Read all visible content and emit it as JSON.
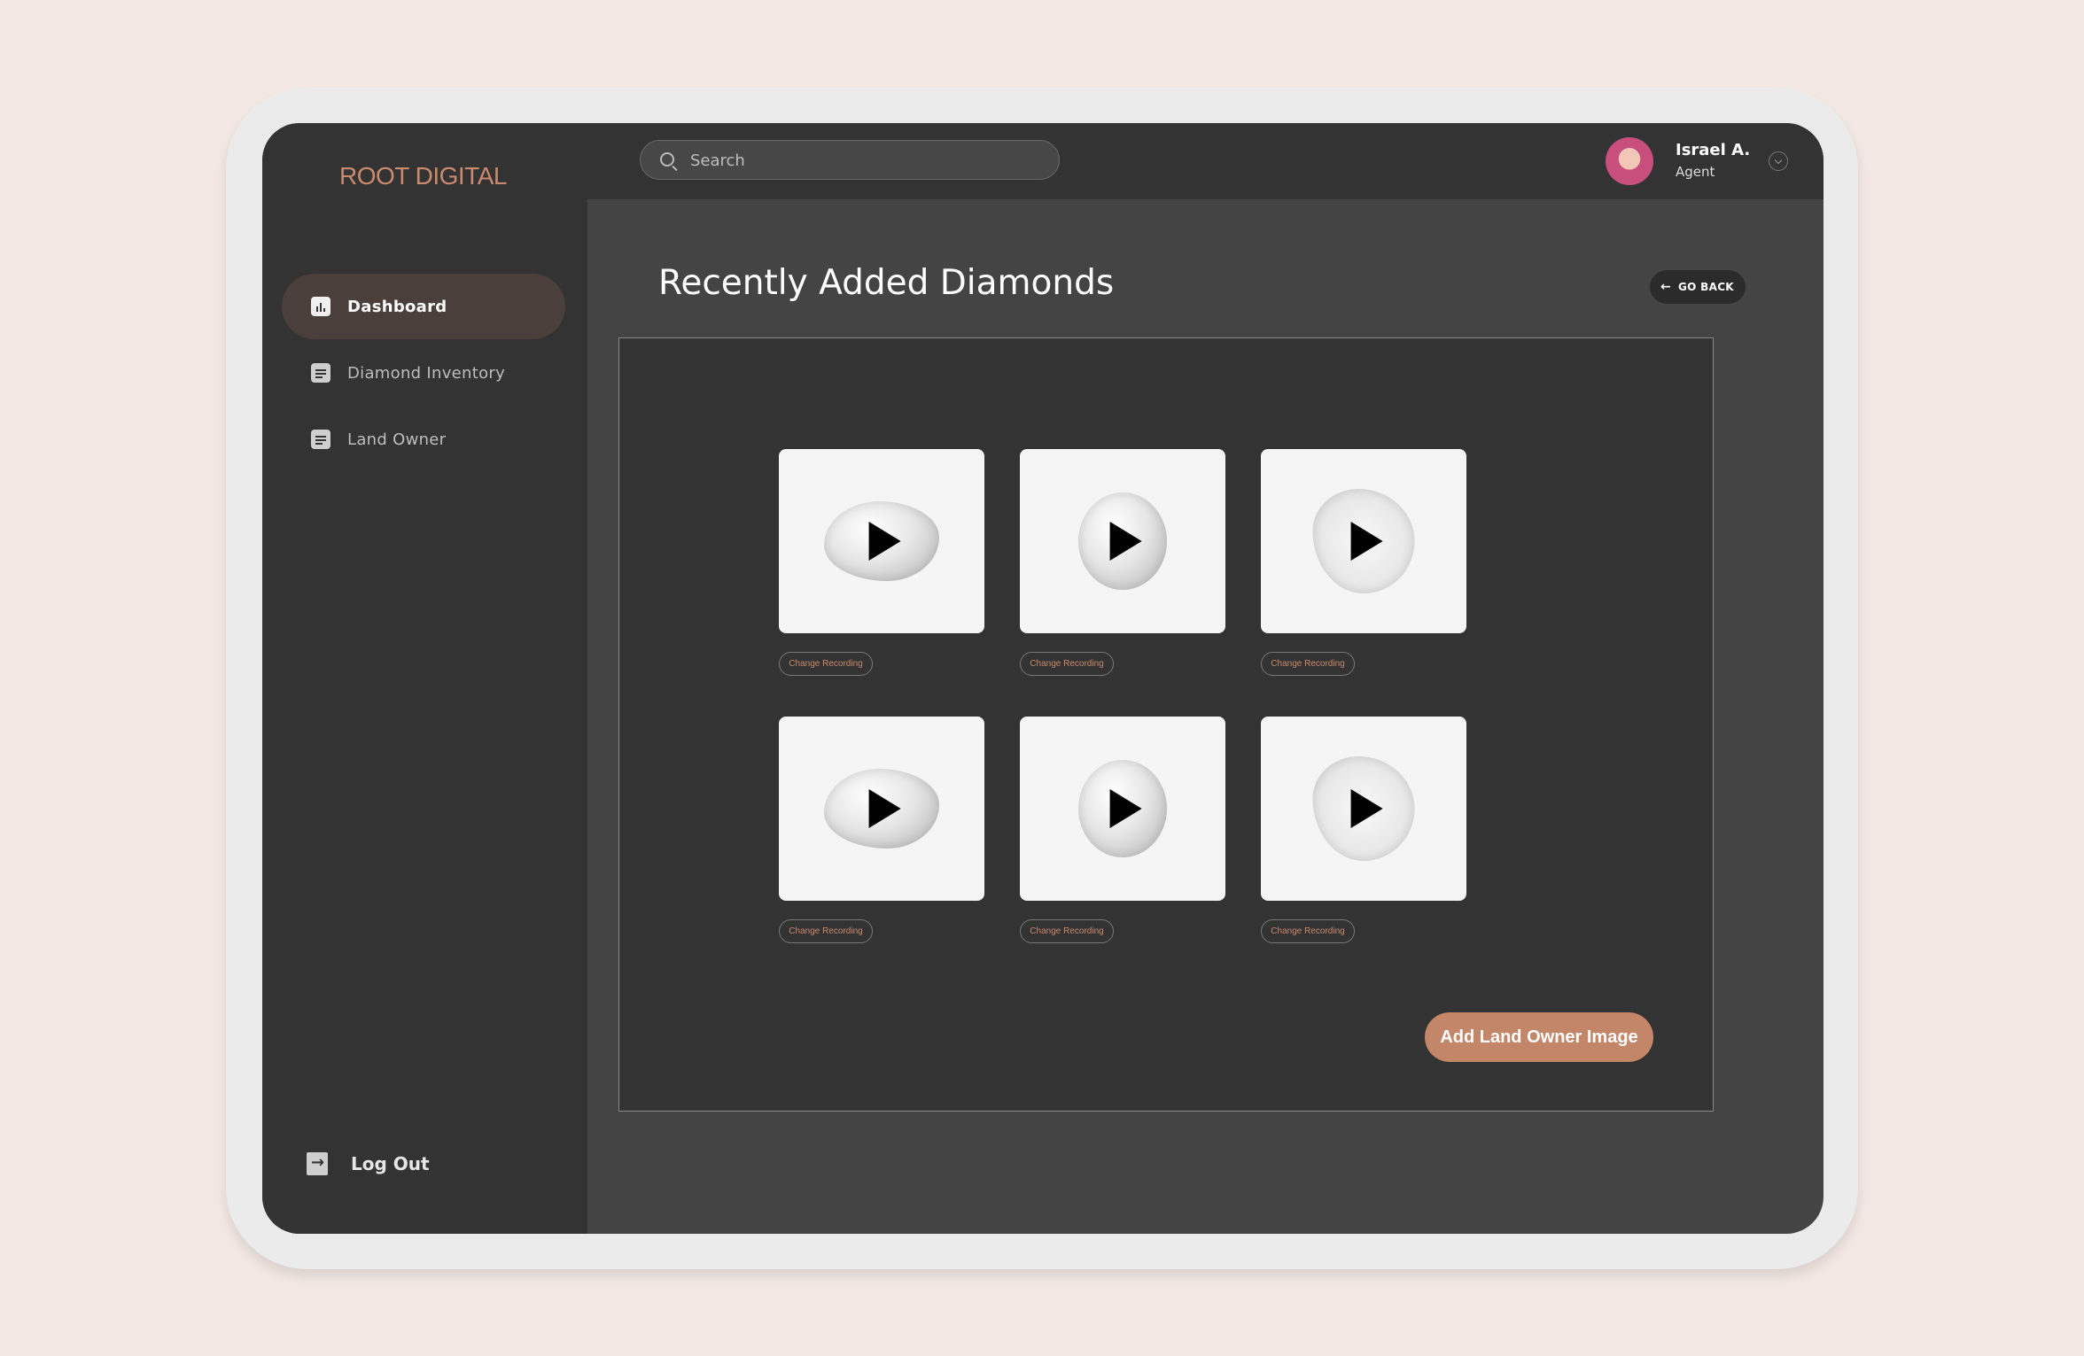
{
  "brand": {
    "logo": "ROOT DIGITAL"
  },
  "sidebar": {
    "items": [
      {
        "label": "Dashboard",
        "icon": "chart-icon",
        "active": true
      },
      {
        "label": "Diamond Inventory",
        "icon": "document-icon",
        "active": false
      },
      {
        "label": "Land Owner",
        "icon": "document-icon",
        "active": false
      }
    ],
    "logout": {
      "label": "Log Out",
      "icon": "logout-icon"
    }
  },
  "header": {
    "search": {
      "placeholder": "Search",
      "value": ""
    },
    "user": {
      "name": "Israel A.",
      "role": "Agent"
    }
  },
  "main": {
    "title": "Recently Added Diamonds",
    "go_back": "GO BACK",
    "cards": [
      {
        "change_label": "Change Recording",
        "icon": "play-icon"
      },
      {
        "change_label": "Change Recording",
        "icon": "play-icon"
      },
      {
        "change_label": "Change Recording",
        "icon": "play-icon"
      },
      {
        "change_label": "Change Recording",
        "icon": "play-icon"
      },
      {
        "change_label": "Change Recording",
        "icon": "play-icon"
      },
      {
        "change_label": "Change Recording",
        "icon": "play-icon"
      }
    ],
    "add_button": "Add Land Owner Image"
  },
  "colors": {
    "accent": "#c48669",
    "logo": "#c98a6e",
    "sidebar_bg": "#333333",
    "content_bg": "#444444",
    "active_nav": "#4a3f3a",
    "page_bg": "#f3e8e3"
  }
}
